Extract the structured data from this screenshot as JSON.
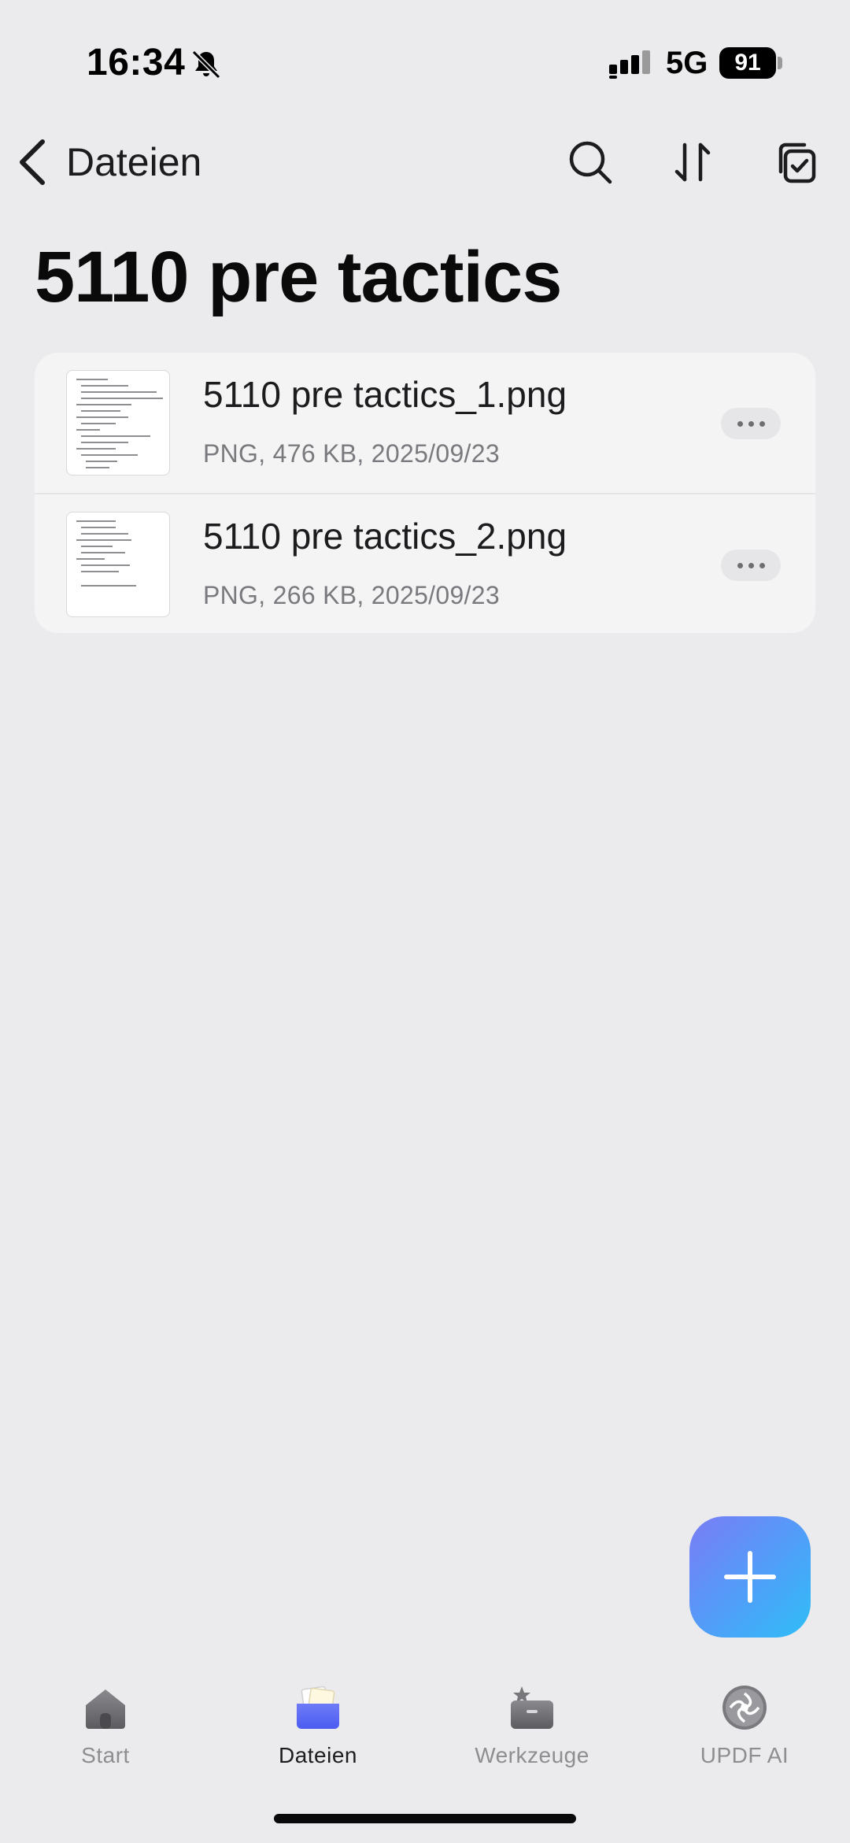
{
  "status_bar": {
    "time": "16:34",
    "network": "5G",
    "battery": "91"
  },
  "nav": {
    "back_label": "Dateien",
    "icons": [
      "search-icon",
      "sort-icon",
      "select-icon"
    ]
  },
  "page": {
    "title": "5110 pre tactics"
  },
  "files": [
    {
      "name": "5110 pre tactics_1.png",
      "meta": "PNG, 476 KB, 2025/09/23"
    },
    {
      "name": "5110 pre tactics_2.png",
      "meta": "PNG, 266 KB, 2025/09/23"
    }
  ],
  "fab": {
    "icon": "plus-icon"
  },
  "tabs": [
    {
      "label": "Start",
      "icon": "home-icon",
      "active": false
    },
    {
      "label": "Dateien",
      "icon": "folder-icon",
      "active": true
    },
    {
      "label": "Werkzeuge",
      "icon": "toolbox-icon",
      "active": false
    },
    {
      "label": "UPDF AI",
      "icon": "ai-icon",
      "active": false
    }
  ],
  "colors": {
    "background": "#ebebed",
    "fab_gradient_start": "#7b7cf6",
    "fab_gradient_end": "#2fbef7",
    "active_tab_icon": "#5b6cf5"
  }
}
